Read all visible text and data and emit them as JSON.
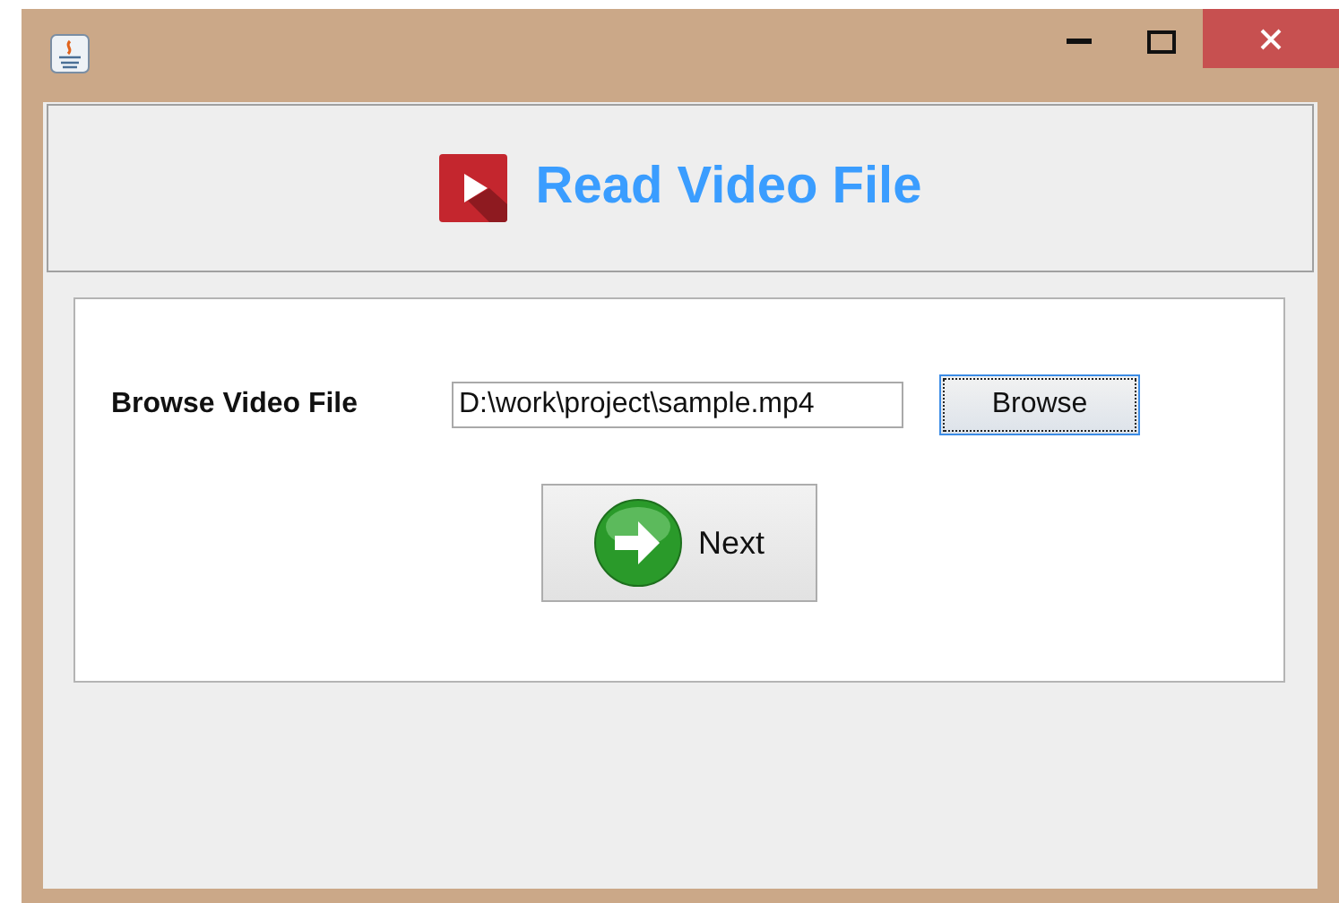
{
  "header": {
    "title": "Read Video File"
  },
  "form": {
    "label": "Browse Video File",
    "file_field": {
      "value": "D:\\work\\project\\sample.mp4"
    },
    "browse_button": {
      "label": "Browse",
      "focused": true
    },
    "next_button": {
      "label": "Next"
    }
  }
}
